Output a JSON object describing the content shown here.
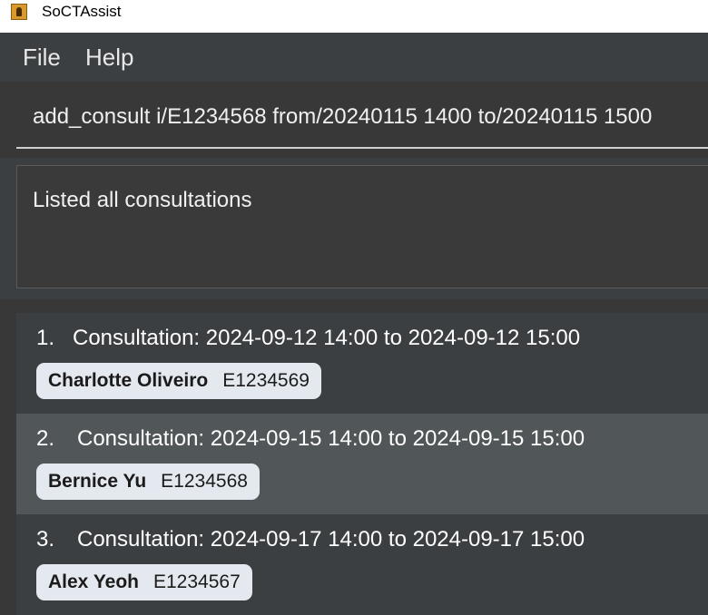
{
  "window": {
    "title": "SoCTAssist",
    "icon": "app-icon"
  },
  "menu": {
    "items": [
      "File",
      "Help"
    ]
  },
  "command": {
    "value": "add_consult i/E1234568 from/20240115 1400 to/20240115 1500"
  },
  "result": {
    "text": "Listed all consultations"
  },
  "consultations": [
    {
      "index": "1.",
      "title": "Consultation: 2024-09-12 14:00 to 2024-09-12 15:00",
      "student_name": "Charlotte Oliveiro",
      "student_id": "E1234569"
    },
    {
      "index": "2.",
      "title": "Consultation: 2024-09-15 14:00 to 2024-09-15 15:00",
      "student_name": "Bernice Yu",
      "student_id": "E1234568"
    },
    {
      "index": "3.",
      "title": "Consultation: 2024-09-17 14:00 to 2024-09-17 15:00",
      "student_name": "Alex Yeoh",
      "student_id": "E1234567"
    }
  ],
  "colors": {
    "background": "#3c3f41",
    "selected_row": "#515658",
    "tag": "#e4e9ef"
  }
}
